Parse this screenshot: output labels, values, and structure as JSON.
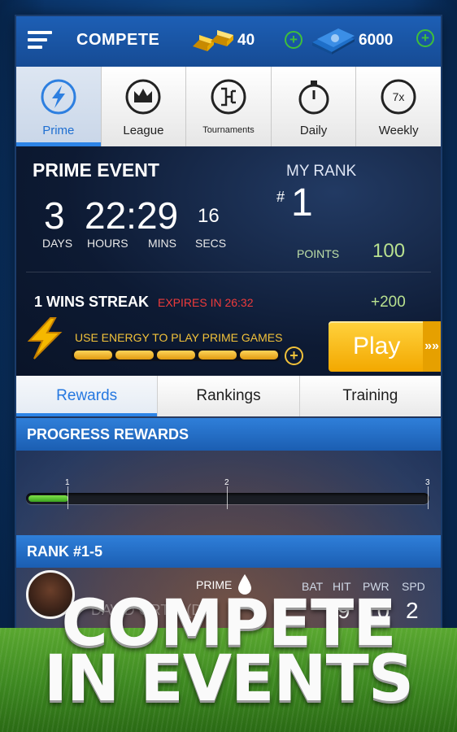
{
  "topbar": {
    "title": "COMPETE",
    "gold": "40",
    "cash": "6000",
    "icons": [
      "menu-icon",
      "gold-bars-icon",
      "plus-icon",
      "cash-stack-icon",
      "plus-icon"
    ]
  },
  "mode_tabs": [
    {
      "label": "Prime",
      "icon": "lightning-icon",
      "active": true
    },
    {
      "label": "League",
      "icon": "crown-icon",
      "active": false
    },
    {
      "label": "Tournaments",
      "icon": "bracket-icon",
      "active": false
    },
    {
      "label": "Daily",
      "icon": "stopwatch-icon",
      "active": false
    },
    {
      "label": "Weekly",
      "icon": "seven-x-icon",
      "icon_text": "7x",
      "active": false
    }
  ],
  "event": {
    "title": "PRIME EVENT",
    "countdown": {
      "days": "3",
      "hours_mins": "22:29",
      "secs": "16",
      "labels": {
        "days": "DAYS",
        "hours": "HOURS",
        "mins": "MINS",
        "secs": "SECS"
      }
    },
    "my_rank_label": "MY RANK",
    "rank_hash": "#",
    "rank": "1",
    "points_label": "POINTS",
    "points": "100",
    "streak": "1 WINS STREAK",
    "expires": "EXPIRES IN 26:32",
    "streak_bonus": "+200",
    "energy_label": "USE ENERGY TO PLAY PRIME GAMES",
    "energy_plus": "+",
    "energy_level": 1.0,
    "play_label": "Play",
    "play_arrows": "»»"
  },
  "sub_tabs": [
    {
      "label": "Rewards",
      "active": true
    },
    {
      "label": "Rankings",
      "active": false
    },
    {
      "label": "Training",
      "active": false
    }
  ],
  "progress": {
    "header": "PROGRESS REWARDS",
    "tick_labels": [
      "1",
      "2",
      "3"
    ],
    "progress_fraction": 0.1
  },
  "rank_section": {
    "header": "RANK #1-5",
    "player": {
      "name": "DAVID ORTIZ (DH)",
      "tier": "PRIME",
      "stat_headers": [
        "BAT",
        "HIT",
        "PWR",
        "SPD"
      ],
      "stat_values": [
        "",
        "9",
        "10",
        "2"
      ]
    }
  },
  "promo": {
    "line1": "COMPETE",
    "line2": "IN EVENTS"
  },
  "colors": {
    "accent_blue": "#2d84e6",
    "gold": "#f2c23a",
    "green": "#3fbf3a",
    "red": "#ef3b3b"
  }
}
